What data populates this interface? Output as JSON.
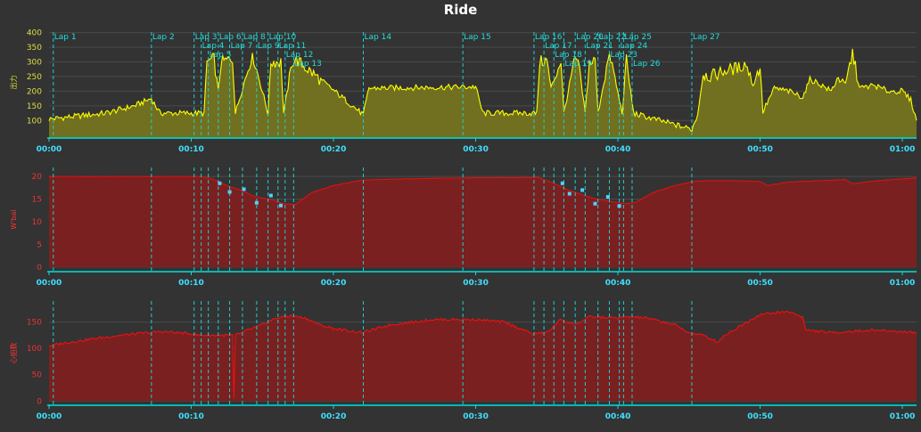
{
  "title": "Ride",
  "colors": {
    "background": "#333333",
    "axis": "#00e0e0",
    "tick_label": "#3fe0ff",
    "lap_line": "#22cccc",
    "lap_label": "#22dddd",
    "power_line": "#ffff00",
    "power_fill": "#707020",
    "wbal_line": "#e01010",
    "wbal_fill": "#7a2020",
    "hr_line": "#ee1010",
    "hr_fill": "#7a2020",
    "marker": "#55d0ff",
    "grid": "#4a4a4a"
  },
  "chart_data": [
    {
      "type": "area",
      "name": "power",
      "ylabel": "出力",
      "ylim": [
        40,
        420
      ],
      "y_ticks": [
        100,
        150,
        200,
        250,
        300,
        350,
        400
      ],
      "x_range_min": [
        0,
        61
      ],
      "x_ticks": [
        "00:00",
        "00:10",
        "00:20",
        "00:30",
        "00:40",
        "00:50",
        "01:00"
      ],
      "series": [
        {
          "x": [
            0,
            2,
            4,
            6,
            7.2,
            7.8,
            10,
            10.9,
            11.1,
            11.6,
            11.9,
            12.1,
            12.9,
            13.1,
            14.2,
            14.4,
            15.4,
            15.6,
            16.3,
            16.5,
            17.1,
            17.3,
            22.1,
            22.5,
            30,
            30.5,
            34.3,
            34.5,
            35,
            35.3,
            36,
            36.2,
            36.9,
            37.2,
            37.7,
            38,
            38.4,
            38.6,
            39.3,
            39.5,
            40.3,
            40.6,
            41.1,
            41.4,
            45.2,
            45.6,
            46,
            46.5,
            47.5,
            48.5,
            49,
            49.5,
            50,
            50.2,
            51,
            52,
            53,
            53.5,
            54,
            55,
            55.5,
            56,
            56.5,
            57,
            58,
            59,
            60,
            60.6,
            61
          ],
          "y": [
            105,
            115,
            125,
            150,
            175,
            125,
            125,
            125,
            300,
            310,
            200,
            300,
            310,
            125,
            310,
            310,
            125,
            300,
            300,
            125,
            300,
            310,
            120,
            210,
            215,
            125,
            125,
            300,
            305,
            210,
            305,
            125,
            295,
            305,
            125,
            295,
            305,
            125,
            305,
            310,
            125,
            305,
            125,
            120,
            70,
            120,
            260,
            250,
            270,
            280,
            295,
            220,
            285,
            130,
            210,
            200,
            180,
            240,
            230,
            200,
            250,
            220,
            330,
            210,
            220,
            200,
            200,
            170,
            100
          ]
        }
      ],
      "laps": [
        {
          "label": "Lap 1",
          "t": 0.3,
          "row": 0
        },
        {
          "label": "Lap 2",
          "t": 7.2,
          "row": 0
        },
        {
          "label": "Lap 3",
          "t": 10.2,
          "row": 0
        },
        {
          "label": "Lap 4",
          "t": 10.7,
          "row": 1
        },
        {
          "label": "Lap 5",
          "t": 11.2,
          "row": 2
        },
        {
          "label": "Lap 6",
          "t": 11.9,
          "row": 0
        },
        {
          "label": "Lap 7",
          "t": 12.7,
          "row": 1
        },
        {
          "label": "Lap 8",
          "t": 13.6,
          "row": 0
        },
        {
          "label": "Lap 9",
          "t": 14.6,
          "row": 1
        },
        {
          "label": "Lap 10",
          "t": 15.4,
          "row": 0
        },
        {
          "label": "Lap 11",
          "t": 16.1,
          "row": 1
        },
        {
          "label": "Lap 12",
          "t": 16.6,
          "row": 2
        },
        {
          "label": "Lap 13",
          "t": 17.2,
          "row": 3
        },
        {
          "label": "Lap 14",
          "t": 22.1,
          "row": 0
        },
        {
          "label": "Lap 15",
          "t": 29.1,
          "row": 0
        },
        {
          "label": "Lap 16",
          "t": 34.1,
          "row": 0
        },
        {
          "label": "Lap 17",
          "t": 34.8,
          "row": 1
        },
        {
          "label": "Lap 18",
          "t": 35.5,
          "row": 2
        },
        {
          "label": "Lap 19",
          "t": 36.2,
          "row": 3
        },
        {
          "label": "Lap 20",
          "t": 37.0,
          "row": 0
        },
        {
          "label": "Lap 21",
          "t": 37.7,
          "row": 1
        },
        {
          "label": "Lap 22",
          "t": 38.6,
          "row": 0
        },
        {
          "label": "Lap 23",
          "t": 39.4,
          "row": 2
        },
        {
          "label": "Lap 24",
          "t": 40.1,
          "row": 1
        },
        {
          "label": "Lap 25",
          "t": 40.4,
          "row": 0
        },
        {
          "label": "Lap 26",
          "t": 41.0,
          "row": 3
        },
        {
          "label": "Lap 27",
          "t": 45.2,
          "row": 0
        }
      ]
    },
    {
      "type": "area",
      "name": "wbal",
      "ylabel": "W'bal",
      "ylim": [
        -1,
        22
      ],
      "y_ticks": [
        0,
        5,
        10,
        15,
        20
      ],
      "x_range_min": [
        0,
        61
      ],
      "x_ticks": [
        "00:00",
        "00:10",
        "00:20",
        "00:30",
        "00:40",
        "00:50",
        "01:00"
      ],
      "series": [
        {
          "x": [
            0,
            10.5,
            11.5,
            12.5,
            13.5,
            14.5,
            15.5,
            16.5,
            17.3,
            18.5,
            20,
            22,
            25,
            30,
            34.4,
            35.5,
            36.5,
            37.5,
            38.5,
            39.5,
            40.5,
            41.2,
            42.5,
            44,
            45.5,
            47,
            49,
            50,
            50.5,
            52,
            56,
            56.5,
            58,
            61
          ],
          "y": [
            20,
            20,
            19.5,
            18,
            17,
            15.5,
            15,
            14,
            13.8,
            16.5,
            18,
            19.2,
            19.5,
            19.7,
            19.8,
            18.5,
            17,
            16,
            15,
            14.5,
            14,
            14.2,
            16.5,
            18,
            19,
            19.1,
            19,
            18.9,
            18,
            18.8,
            19.3,
            18.4,
            19,
            19.7
          ]
        }
      ],
      "markers": [
        {
          "t": 12.0,
          "v": 18.5
        },
        {
          "t": 12.7,
          "v": 16.6
        },
        {
          "t": 13.7,
          "v": 17.2
        },
        {
          "t": 14.6,
          "v": 14.2
        },
        {
          "t": 15.6,
          "v": 15.8
        },
        {
          "t": 16.3,
          "v": 13.6
        },
        {
          "t": 36.1,
          "v": 18.5
        },
        {
          "t": 36.6,
          "v": 16.2
        },
        {
          "t": 37.5,
          "v": 17.0
        },
        {
          "t": 38.4,
          "v": 14.0
        },
        {
          "t": 39.3,
          "v": 15.5
        },
        {
          "t": 40.1,
          "v": 13.5
        }
      ]
    },
    {
      "type": "area",
      "name": "heart_rate",
      "ylabel": "心拍数",
      "ylim": [
        -8,
        190
      ],
      "y_ticks": [
        0,
        50,
        100,
        150
      ],
      "x_range_min": [
        0,
        61
      ],
      "x_ticks": [
        "00:00",
        "00:10",
        "00:20",
        "00:30",
        "00:40",
        "00:50",
        "01:00"
      ],
      "series": [
        {
          "x": [
            0,
            1,
            3,
            5,
            7,
            8,
            10,
            10.5,
            12,
            12.9,
            13.0,
            13.1,
            14,
            15,
            16,
            17,
            18,
            19,
            20,
            22,
            24,
            27,
            30,
            32,
            34,
            35,
            36,
            37,
            38,
            40,
            41,
            42,
            44,
            45,
            46,
            47,
            47.5,
            50,
            52,
            53,
            53.2,
            55,
            58,
            61
          ],
          "y": [
            105,
            110,
            118,
            125,
            130,
            132,
            128,
            125,
            125,
            125,
            5,
            125,
            135,
            145,
            158,
            162,
            158,
            145,
            138,
            130,
            145,
            155,
            155,
            150,
            128,
            130,
            155,
            145,
            160,
            158,
            160,
            158,
            145,
            130,
            125,
            112,
            125,
            165,
            170,
            160,
            135,
            130,
            135,
            130
          ]
        }
      ]
    }
  ]
}
